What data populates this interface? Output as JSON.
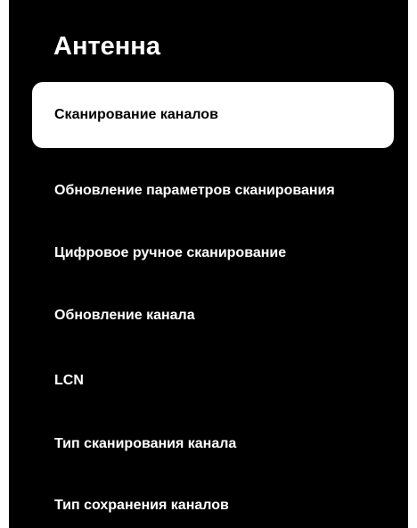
{
  "screen": {
    "title": "Антенна",
    "menu": {
      "items": [
        {
          "label": "Сканирование каналов",
          "selected": true
        },
        {
          "label": "Обновление параметров сканирования",
          "selected": false
        },
        {
          "label": "Цифровое ручное сканирование",
          "selected": false
        },
        {
          "label": "Обновление канала",
          "selected": false
        },
        {
          "label": "LCN",
          "selected": false
        },
        {
          "label": "Тип сканирования канала",
          "selected": false
        },
        {
          "label": "Тип сохранения каналов",
          "selected": false
        }
      ]
    }
  },
  "colors": {
    "panel_background": "#000000",
    "text": "#ffffff",
    "selected_background": "#ffffff",
    "selected_text": "#000000"
  }
}
